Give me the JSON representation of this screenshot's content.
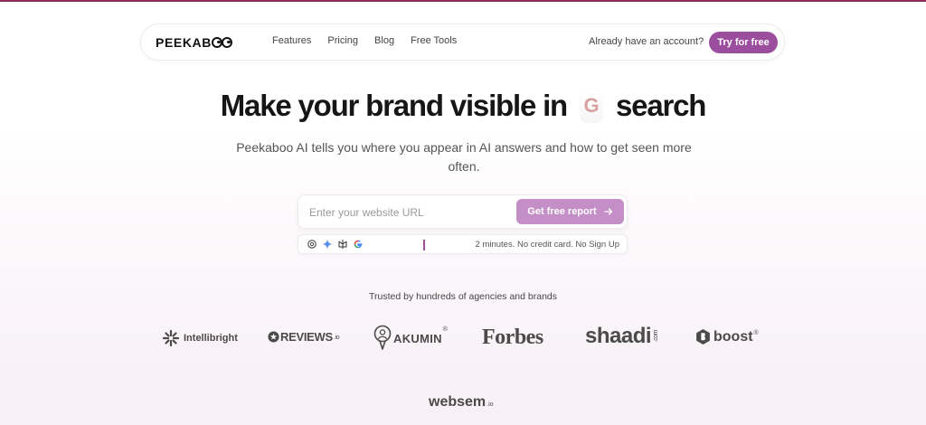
{
  "nav": {
    "logo": "PEEKAB",
    "links": [
      "Features",
      "Pricing",
      "Blog",
      "Free Tools"
    ],
    "signin": "Already have an account?",
    "cta": "Try for free"
  },
  "hero": {
    "title_before": "Make your brand visible in",
    "g_letter": "G",
    "title_after": "search",
    "subtitle": "Peekaboo AI tells you where you appear in AI answers and how to get seen more often."
  },
  "form": {
    "placeholder": "Enter your website URL",
    "value": "",
    "button": "Get free report",
    "button_icon": "arrow-right-icon",
    "info_icons": [
      "openai-icon",
      "gemini-icon",
      "perplexity-icon",
      "google-icon"
    ],
    "info": "2 minutes. No credit card. No Sign Up"
  },
  "trusted": {
    "heading": "Trusted by hundreds of agencies and brands",
    "brands": {
      "intellibright": "Intellibright",
      "reviews": "REVIEWS",
      "reviews_suffix": ".io",
      "akumin": "AKUMIN",
      "akumin_mark": "®",
      "forbes": "Forbes",
      "shaadi": "shaadi",
      "shaadi_suffix": ".com",
      "boost": "boost",
      "boost_mark": "®",
      "websem": "websem",
      "websem_suffix": ".io"
    }
  },
  "colors": {
    "accent": "#9b4d9e",
    "button_light": "#c48fc7",
    "top_line": "#8e2a5c"
  }
}
